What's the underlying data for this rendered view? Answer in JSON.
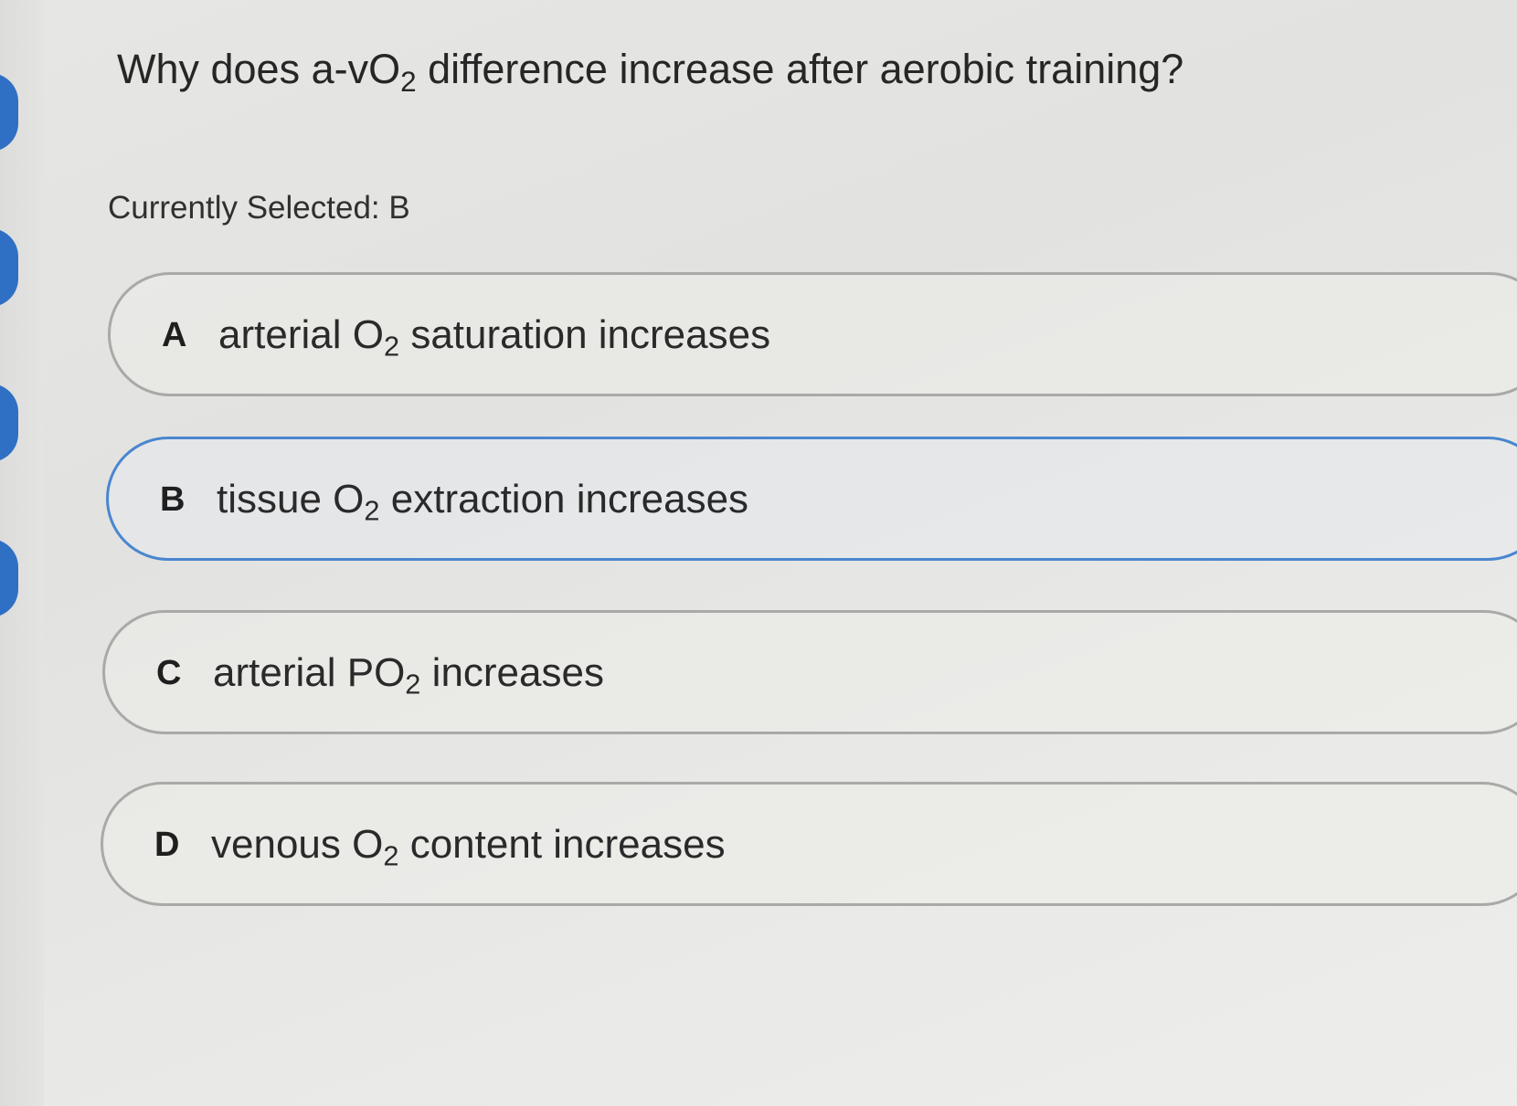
{
  "question": {
    "pre": "Why does a-vO",
    "sub": "2",
    "post": " difference increase after aerobic training?"
  },
  "selection": {
    "label": "Currently Selected:",
    "value": "B"
  },
  "options": [
    {
      "letter": "A",
      "pre": "arterial O",
      "sub": "2",
      "post": " saturation increases",
      "selected": false
    },
    {
      "letter": "B",
      "pre": "tissue O",
      "sub": "2",
      "post": " extraction increases",
      "selected": true
    },
    {
      "letter": "C",
      "pre": "arterial PO",
      "sub": "2",
      "post": " increases",
      "selected": false
    },
    {
      "letter": "D",
      "pre": "venous O",
      "sub": "2",
      "post": " content increases",
      "selected": false
    }
  ],
  "colors": {
    "selected_border": "#4a86cf",
    "unselected_border": "#a9a9a7",
    "rail_accent": "#2f6fc4"
  }
}
